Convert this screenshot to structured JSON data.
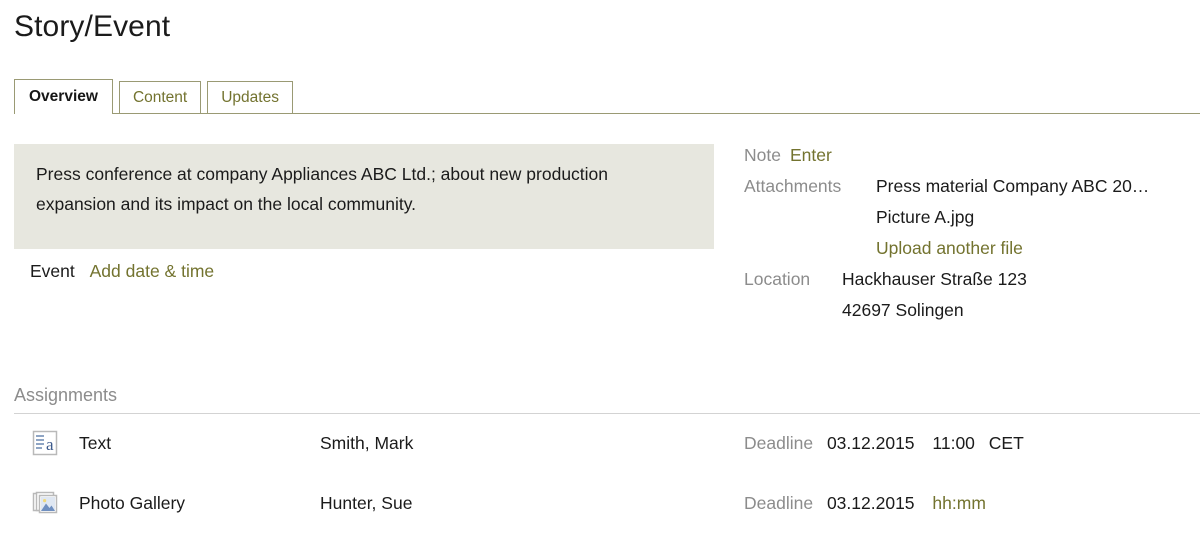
{
  "page": {
    "title": "Story/Event"
  },
  "tabs": [
    {
      "label": "Overview",
      "active": true
    },
    {
      "label": "Content",
      "active": false
    },
    {
      "label": "Updates",
      "active": false
    }
  ],
  "overview": {
    "description": "Press conference at company Appliances ABC Ltd.; about new production expansion and its impact on the local community.",
    "event": {
      "label": "Event",
      "action_label": "Add date & time"
    },
    "meta": {
      "note": {
        "label": "Note",
        "action_label": "Enter"
      },
      "attachments": {
        "label": "Attachments",
        "files": [
          "Press material Company ABC 20…",
          "Picture A.jpg"
        ],
        "action_label": "Upload another file"
      },
      "location": {
        "label": "Location",
        "street": "Hackhauser Straße 123",
        "city": "42697 Solingen"
      }
    }
  },
  "assignments": {
    "title": "Assignments",
    "deadline_label": "Deadline",
    "rows": [
      {
        "icon": "text-document-icon",
        "type": "Text",
        "person": "Smith, Mark",
        "deadline_date": "03.12.2015",
        "deadline_time": "11:00",
        "deadline_timezone": "CET",
        "time_is_placeholder": false
      },
      {
        "icon": "photo-gallery-icon",
        "type": "Photo Gallery",
        "person": "Hunter, Sue",
        "deadline_date": "03.12.2015",
        "deadline_time": "hh:mm",
        "deadline_timezone": "",
        "time_is_placeholder": true
      }
    ]
  },
  "colors": {
    "accent_olive": "#73732f",
    "label_gray": "#8c8c8c",
    "panel_bg": "#e7e7df",
    "tab_border": "#9a9a74",
    "rule_gray": "#d3d3d3"
  }
}
